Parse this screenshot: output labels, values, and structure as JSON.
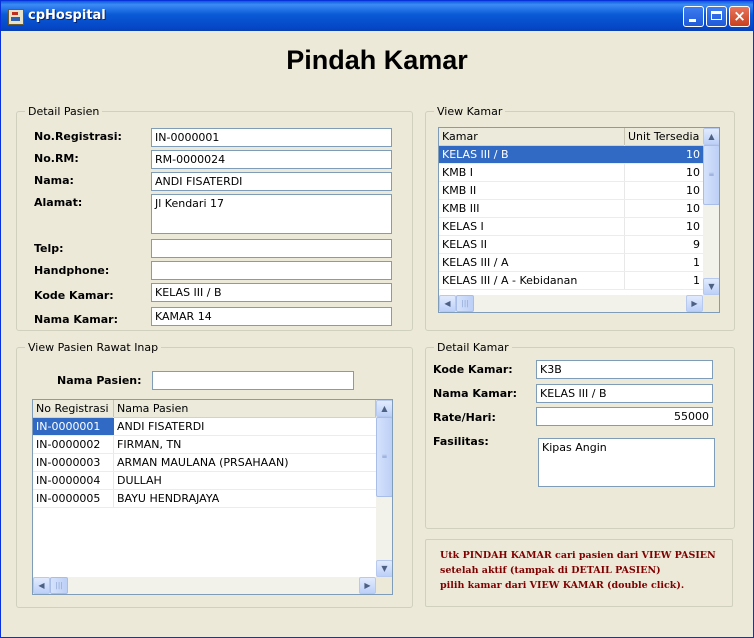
{
  "window": {
    "title": "cpHospital"
  },
  "page": {
    "title": "Pindah Kamar"
  },
  "detail_pasien": {
    "legend": "Detail Pasien",
    "no_registrasi_label": "No.Registrasi:",
    "no_registrasi": "IN-0000001",
    "no_rm_label": "No.RM:",
    "no_rm": "RM-0000024",
    "nama_label": "Nama:",
    "nama": "ANDI FISATERDI",
    "alamat_label": "Alamat:",
    "alamat": "Jl Kendari 17",
    "telp_label": "Telp:",
    "telp": "",
    "handphone_label": "Handphone:",
    "handphone": "",
    "kode_kamar_label": "Kode Kamar:",
    "kode_kamar": "KELAS  III / B",
    "nama_kamar_label": "Nama Kamar:",
    "nama_kamar": "KAMAR 14"
  },
  "view_kamar": {
    "legend": "View Kamar",
    "columns": [
      "Kamar",
      "Unit Tersedia"
    ],
    "rows": [
      {
        "kamar": "KELAS  III / B",
        "unit": "10"
      },
      {
        "kamar": "KMB  I",
        "unit": "10"
      },
      {
        "kamar": "KMB II",
        "unit": "10"
      },
      {
        "kamar": "KMB III",
        "unit": "10"
      },
      {
        "kamar": "KELAS I",
        "unit": "10"
      },
      {
        "kamar": "KELAS II",
        "unit": "9"
      },
      {
        "kamar": "KELAS  III / A",
        "unit": "1"
      },
      {
        "kamar": "KELAS  III / A - Kebidanan",
        "unit": "1"
      }
    ],
    "selected_index": 0
  },
  "view_pasien": {
    "legend": "View Pasien Rawat Inap",
    "search_label": "Nama Pasien:",
    "search_value": "",
    "columns": [
      "No Registrasi",
      "Nama Pasien"
    ],
    "rows": [
      {
        "no": "IN-0000001",
        "nama": "ANDI FISATERDI"
      },
      {
        "no": "IN-0000002",
        "nama": "FIRMAN, TN"
      },
      {
        "no": "IN-0000003",
        "nama": "ARMAN MAULANA (PRSAHAAN)"
      },
      {
        "no": "IN-0000004",
        "nama": "DULLAH"
      },
      {
        "no": "IN-0000005",
        "nama": "BAYU HENDRAJAYA"
      }
    ],
    "selected_index": 0
  },
  "detail_kamar": {
    "legend": "Detail Kamar",
    "kode_kamar_label": "Kode Kamar:",
    "kode_kamar": "K3B",
    "nama_kamar_label": "Nama Kamar:",
    "nama_kamar": "KELAS  III / B",
    "rate_label": "Rate/Hari:",
    "rate": "55000",
    "fasilitas_label": "Fasilitas:",
    "fasilitas": "Kipas Angin"
  },
  "note": {
    "line1": "Utk PINDAH KAMAR cari pasien dari VIEW PASIEN",
    "line2": "setelah aktif (tampak di DETAIL PASIEN)",
    "line3": "pilih kamar dari VIEW KAMAR (double click).",
    "color": "#800000"
  },
  "colors": {
    "selection": "#316ac5",
    "titlebar": "#0a5be0"
  }
}
